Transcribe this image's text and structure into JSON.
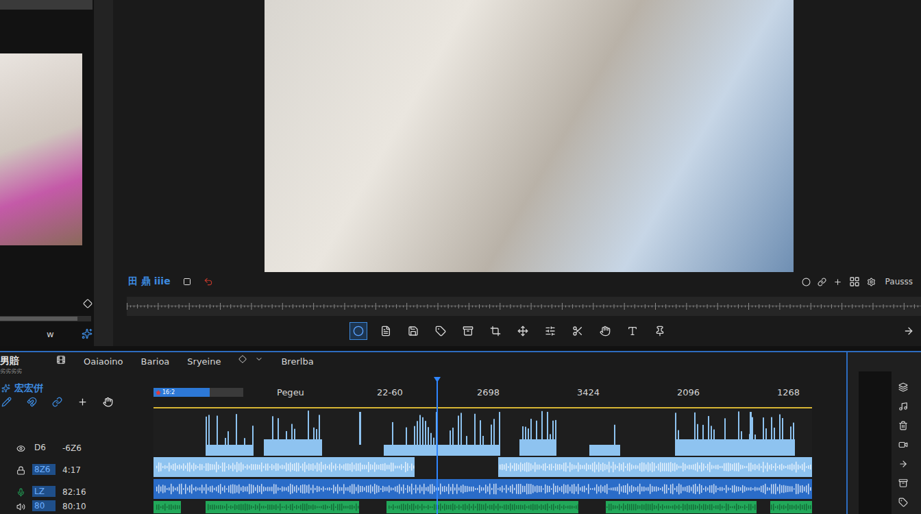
{
  "source_monitor": {
    "footer_label": "w",
    "scrub_level": 0.85
  },
  "program_monitor": {
    "left_label": "田 鼎 iiie",
    "right_label": "Pausss"
  },
  "tools": [
    {
      "selected": true
    },
    {
      "selected": false
    },
    {
      "selected": false
    },
    {
      "selected": false
    },
    {
      "selected": false
    },
    {
      "selected": false
    },
    {
      "selected": false
    },
    {
      "selected": false
    },
    {
      "selected": false
    },
    {
      "selected": false
    },
    {
      "selected": false
    },
    {
      "selected": false
    }
  ],
  "timeline": {
    "title": "男賠",
    "subtitle": "劣劣劣劣",
    "menu": [
      "Oaiaoino",
      "Barioa",
      "Sryeine",
      "Brerlba"
    ],
    "sequence_label": "宏宏倂",
    "marker": {
      "label": "16:2",
      "level": 0.6
    },
    "ruler": [
      "Pegeu",
      "22-60",
      "2698",
      "3424",
      "2096",
      "1268"
    ],
    "playhead": 0.43,
    "tracks": [
      {
        "name": "D6",
        "value": "-6Z6",
        "highlighted": false,
        "kind": "clips",
        "color": "#8ec3f0"
      },
      {
        "name": "8Z6",
        "value": "4:17",
        "highlighted": true,
        "kind": "band",
        "color": "#8ec3f0"
      },
      {
        "name": "LZ",
        "value": "82:16",
        "highlighted": true,
        "kind": "band",
        "color": "#2a6cc8"
      },
      {
        "name": "80",
        "value": "80:10",
        "highlighted": true,
        "kind": "band",
        "color": "#22a85a"
      }
    ]
  }
}
